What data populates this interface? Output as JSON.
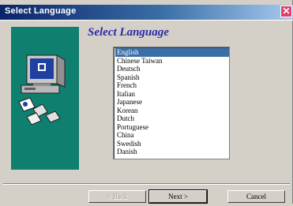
{
  "window": {
    "title": "Select Language",
    "close_glyph": "✕"
  },
  "main": {
    "heading": "Select Language"
  },
  "language_list": {
    "items": [
      "English",
      "Chinese Taiwan",
      "Deutsch",
      "Spanish",
      "French",
      "Italian",
      "Japanese",
      "Korean",
      "Dutch",
      "Portuguese",
      "China",
      "Swedish",
      "Danish"
    ],
    "selected": "English"
  },
  "buttons": {
    "back": "< Back",
    "next": "Next >",
    "cancel": "Cancel"
  },
  "colors": {
    "sidebar": "#0f7f70",
    "heading": "#2a2aa8",
    "selection": "#3a6ea5"
  },
  "icons": {
    "close": "close-icon",
    "computer": "computer-icon",
    "globe": "globe-icon",
    "disks": "floppy-disk-icon"
  }
}
